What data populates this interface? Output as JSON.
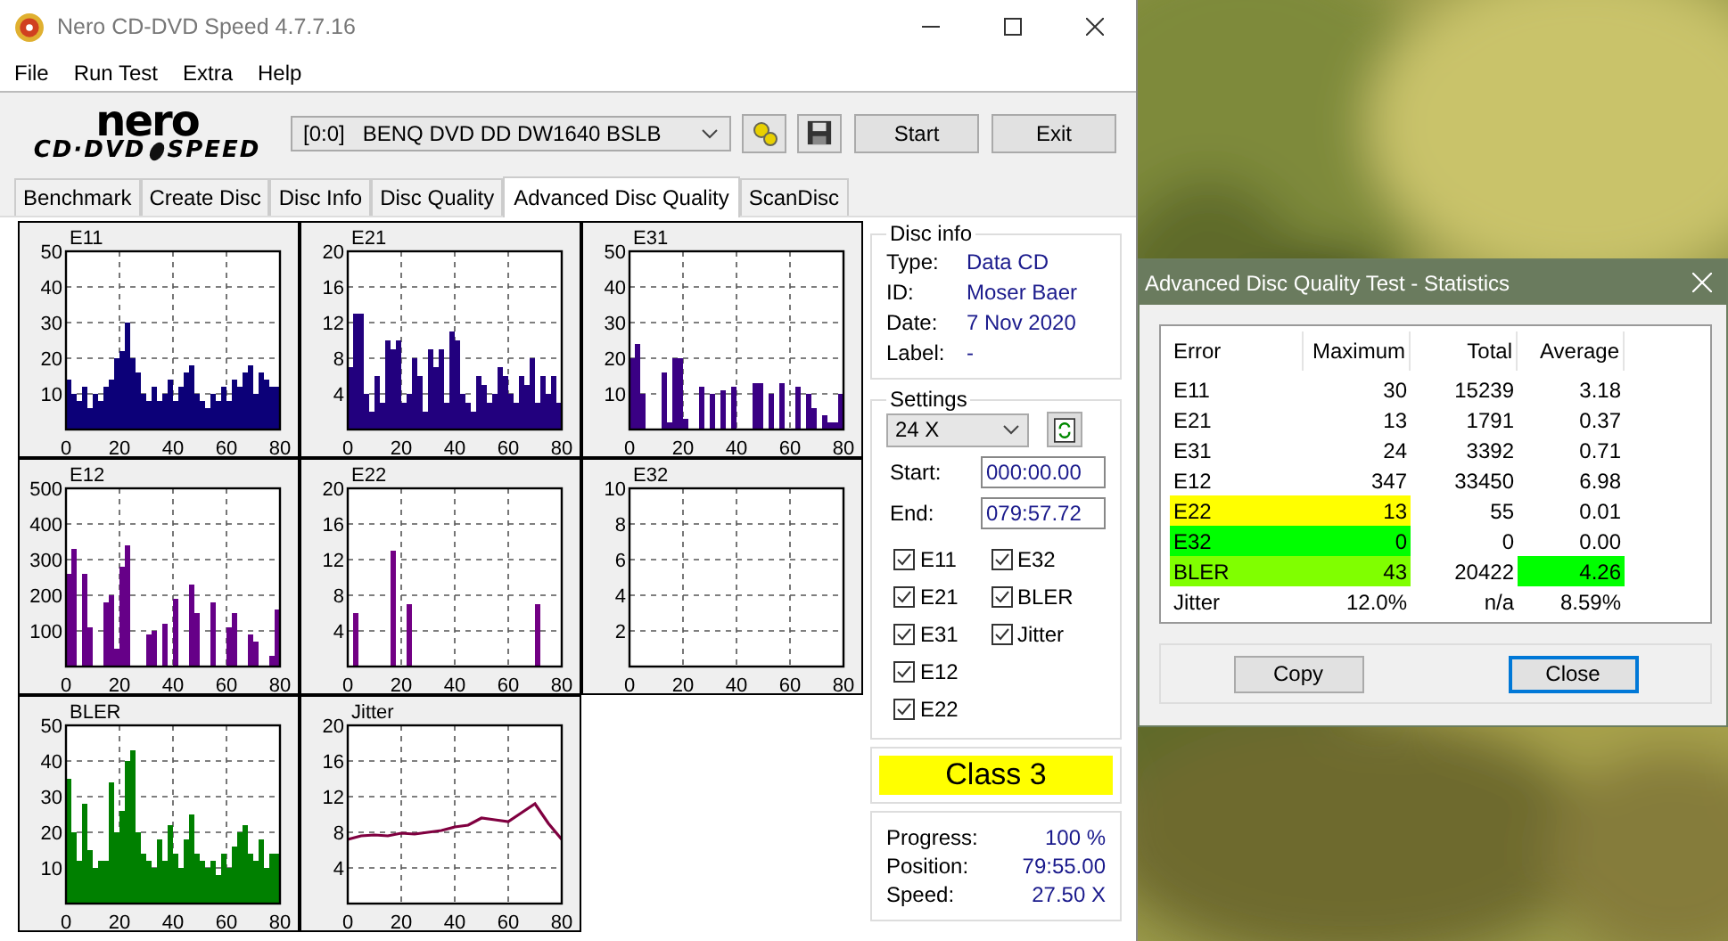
{
  "window": {
    "title": "Nero CD-DVD Speed 4.7.7.16"
  },
  "menu": [
    "File",
    "Run Test",
    "Extra",
    "Help"
  ],
  "logo": {
    "brand": "nero",
    "line1": "CD·DVD",
    "line2": "SPEED"
  },
  "toolbar": {
    "drive": "[0:0]   BENQ DVD DD DW1640 BSLB",
    "buttons": [
      "Start",
      "Exit"
    ]
  },
  "tabs": [
    {
      "label": "Benchmark",
      "selected": false
    },
    {
      "label": "Create Disc",
      "selected": false
    },
    {
      "label": "Disc Info",
      "selected": false
    },
    {
      "label": "Disc Quality",
      "selected": false
    },
    {
      "label": "Advanced Disc Quality",
      "selected": true
    },
    {
      "label": "ScanDisc",
      "selected": false
    }
  ],
  "charts": [
    {
      "chart_data": {
        "type": "bar",
        "title": "E11",
        "x": [
          0,
          2,
          4,
          6,
          8,
          10,
          12,
          14,
          16,
          18,
          20,
          22,
          24,
          26,
          28,
          30,
          32,
          34,
          36,
          38,
          40,
          42,
          44,
          46,
          48,
          50,
          52,
          54,
          56,
          58,
          60,
          62,
          64,
          66,
          68,
          70,
          72,
          74,
          76,
          78
        ],
        "series": [
          {
            "color": "#0c0078",
            "values": [
              14,
              10,
              8,
              12,
              6,
              10,
              8,
              12,
              14,
              20,
              22,
              30,
              20,
              16,
              10,
              8,
              12,
              8,
              10,
              14,
              8,
              12,
              16,
              18,
              10,
              8,
              6,
              10,
              8,
              12,
              8,
              14,
              12,
              16,
              18,
              10,
              16,
              14,
              12,
              12
            ]
          }
        ],
        "xlim": [
          0,
          80
        ],
        "ylim": [
          0,
          50
        ],
        "xticks": [
          0,
          20,
          40,
          60,
          80
        ],
        "yticks": [
          10,
          20,
          30,
          40,
          50
        ],
        "grid": true
      }
    },
    {
      "chart_data": {
        "type": "bar",
        "title": "E21",
        "x": [
          0,
          2,
          4,
          6,
          8,
          10,
          12,
          14,
          16,
          18,
          20,
          22,
          24,
          26,
          28,
          30,
          32,
          34,
          36,
          38,
          40,
          42,
          44,
          46,
          48,
          50,
          52,
          54,
          56,
          58,
          60,
          62,
          64,
          66,
          68,
          70,
          72,
          74,
          76,
          78
        ],
        "series": [
          {
            "color": "#22007e",
            "values": [
              7,
              13,
              13,
              4,
              2,
              6,
              3,
              10,
              9,
              10,
              3,
              4,
              8,
              6,
              2,
              9,
              7,
              9,
              3,
              11,
              10,
              4,
              3,
              2,
              6,
              5,
              3,
              4,
              7,
              6,
              4,
              3,
              6,
              5,
              8,
              3,
              6,
              4,
              6,
              3
            ]
          }
        ],
        "xlim": [
          0,
          80
        ],
        "ylim": [
          0,
          20
        ],
        "xticks": [
          0,
          20,
          40,
          60,
          80
        ],
        "yticks": [
          4,
          8,
          12,
          16,
          20
        ],
        "grid": true
      }
    },
    {
      "chart_data": {
        "type": "bar",
        "title": "E31",
        "x": [
          0,
          2,
          4,
          6,
          8,
          10,
          12,
          14,
          16,
          18,
          20,
          22,
          24,
          26,
          28,
          30,
          32,
          34,
          36,
          38,
          40,
          42,
          44,
          46,
          48,
          50,
          52,
          54,
          56,
          58,
          60,
          62,
          64,
          66,
          68,
          70,
          72,
          74,
          76,
          78
        ],
        "series": [
          {
            "color": "#3a0084",
            "values": [
              20,
              24,
              10,
              0,
              0,
              0,
              16,
              2,
              20,
              20,
              3,
              0,
              0,
              12,
              0,
              10,
              0,
              11,
              0,
              12,
              0,
              0,
              0,
              13,
              13,
              0,
              10,
              0,
              13,
              0,
              0,
              12,
              0,
              10,
              6,
              0,
              4,
              2,
              2,
              10
            ]
          }
        ],
        "xlim": [
          0,
          80
        ],
        "ylim": [
          0,
          50
        ],
        "xticks": [
          0,
          20,
          40,
          60,
          80
        ],
        "yticks": [
          10,
          20,
          30,
          40,
          50
        ],
        "grid": true
      }
    },
    {
      "chart_data": {
        "type": "bar",
        "title": "E12",
        "x": [
          0,
          2,
          4,
          6,
          8,
          10,
          12,
          14,
          16,
          18,
          20,
          22,
          24,
          26,
          28,
          30,
          32,
          34,
          36,
          38,
          40,
          42,
          44,
          46,
          48,
          50,
          52,
          54,
          56,
          58,
          60,
          62,
          64,
          66,
          68,
          70,
          72,
          74,
          76,
          78
        ],
        "series": [
          {
            "color": "#660088",
            "values": [
              260,
              330,
              0,
              260,
              110,
              0,
              0,
              180,
              200,
              50,
              280,
              340,
              0,
              0,
              0,
              90,
              100,
              0,
              120,
              0,
              190,
              0,
              0,
              230,
              150,
              0,
              0,
              180,
              0,
              0,
              110,
              150,
              0,
              0,
              90,
              70,
              0,
              0,
              30,
              160
            ]
          }
        ],
        "xlim": [
          0,
          80
        ],
        "ylim": [
          0,
          500
        ],
        "xticks": [
          0,
          20,
          40,
          60,
          80
        ],
        "yticks": [
          100,
          200,
          300,
          400,
          500
        ],
        "grid": true
      }
    },
    {
      "chart_data": {
        "type": "bar",
        "title": "E22",
        "x": [
          0,
          2,
          4,
          6,
          8,
          10,
          12,
          14,
          16,
          18,
          20,
          22,
          24,
          26,
          28,
          30,
          32,
          34,
          36,
          38,
          40,
          42,
          44,
          46,
          48,
          50,
          52,
          54,
          56,
          58,
          60,
          62,
          64,
          66,
          68,
          70,
          72,
          74,
          76,
          78
        ],
        "series": [
          {
            "color": "#720084",
            "values": [
              0,
              6,
              0,
              0,
              0,
              0,
              0,
              0,
              13,
              0,
              0,
              7,
              0,
              0,
              0,
              0,
              0,
              0,
              0,
              0,
              0,
              0,
              0,
              0,
              0,
              0,
              0,
              0,
              0,
              0,
              0,
              0,
              0,
              0,
              0,
              7,
              0,
              0,
              0,
              0
            ]
          }
        ],
        "xlim": [
          0,
          80
        ],
        "ylim": [
          0,
          20
        ],
        "xticks": [
          0,
          20,
          40,
          60,
          80
        ],
        "yticks": [
          4,
          8,
          12,
          16,
          20
        ],
        "grid": true
      }
    },
    {
      "chart_data": {
        "type": "bar",
        "title": "E32",
        "x": [
          0,
          2,
          4,
          6,
          8,
          10,
          12,
          14,
          16,
          18,
          20,
          22,
          24,
          26,
          28,
          30,
          32,
          34,
          36,
          38,
          40,
          42,
          44,
          46,
          48,
          50,
          52,
          54,
          56,
          58,
          60,
          62,
          64,
          66,
          68,
          70,
          72,
          74,
          76,
          78
        ],
        "series": [
          {
            "values": [
              0,
              0,
              0,
              0,
              0,
              0,
              0,
              0,
              0,
              0,
              0,
              0,
              0,
              0,
              0,
              0,
              0,
              0,
              0,
              0,
              0,
              0,
              0,
              0,
              0,
              0,
              0,
              0,
              0,
              0,
              0,
              0,
              0,
              0,
              0,
              0,
              0,
              0,
              0,
              0
            ]
          }
        ],
        "xlim": [
          0,
          80
        ],
        "ylim": [
          0,
          10
        ],
        "xticks": [
          0,
          20,
          40,
          60,
          80
        ],
        "yticks": [
          2,
          4,
          6,
          8,
          10
        ],
        "grid": true
      }
    },
    {
      "chart_data": {
        "type": "bar",
        "title": "BLER",
        "x": [
          0,
          2,
          4,
          6,
          8,
          10,
          12,
          14,
          16,
          18,
          20,
          22,
          24,
          26,
          28,
          30,
          32,
          34,
          36,
          38,
          40,
          42,
          44,
          46,
          48,
          50,
          52,
          54,
          56,
          58,
          60,
          62,
          64,
          66,
          68,
          70,
          72,
          74,
          76,
          78
        ],
        "series": [
          {
            "color": "#008000",
            "values": [
              35,
              20,
              12,
              28,
              15,
              10,
              12,
              12,
              34,
              20,
              26,
              40,
              43,
              20,
              14,
              12,
              10,
              18,
              12,
              22,
              14,
              10,
              18,
              25,
              14,
              12,
              10,
              12,
              8,
              14,
              10,
              16,
              20,
              22,
              14,
              12,
              18,
              10,
              14,
              14
            ]
          }
        ],
        "xlim": [
          0,
          80
        ],
        "ylim": [
          0,
          50
        ],
        "xticks": [
          0,
          20,
          40,
          60,
          80
        ],
        "yticks": [
          10,
          20,
          30,
          40,
          50
        ],
        "grid": true
      }
    },
    {
      "chart_data": {
        "type": "line",
        "title": "Jitter",
        "x": [
          0,
          5,
          10,
          15,
          20,
          25,
          30,
          35,
          40,
          45,
          50,
          55,
          60,
          65,
          70,
          75,
          80
        ],
        "series": [
          {
            "color": "#800040",
            "values": [
              7.2,
              7.6,
              7.7,
              7.6,
              7.9,
              7.8,
              8.0,
              8.2,
              8.6,
              8.8,
              9.6,
              9.4,
              9.2,
              10.2,
              11.2,
              9.0,
              7.2
            ]
          }
        ],
        "xlim": [
          0,
          80
        ],
        "ylim": [
          0,
          20
        ],
        "xticks": [
          0,
          20,
          40,
          60,
          80
        ],
        "yticks": [
          4,
          8,
          12,
          16,
          20
        ],
        "grid": true
      }
    }
  ],
  "disc_info": {
    "title": "Disc info",
    "fields": [
      {
        "label": "Type:",
        "value": "Data CD"
      },
      {
        "label": "ID:",
        "value": "Moser Baer"
      },
      {
        "label": "Date:",
        "value": "7 Nov 2020"
      },
      {
        "label": "Label:",
        "value": "-"
      }
    ]
  },
  "settings": {
    "title": "Settings",
    "speed": "24 X",
    "start_label": "Start:",
    "start": "000:00.00",
    "end_label": "End:",
    "end": "079:57.72",
    "checks": [
      {
        "label": "E11",
        "checked": true
      },
      {
        "label": "E21",
        "checked": true
      },
      {
        "label": "E31",
        "checked": true
      },
      {
        "label": "E12",
        "checked": true
      },
      {
        "label": "E22",
        "checked": true
      },
      {
        "label": "E32",
        "checked": true
      },
      {
        "label": "BLER",
        "checked": true
      },
      {
        "label": "Jitter",
        "checked": true
      }
    ]
  },
  "class": {
    "label": "Class 3",
    "color": "#ffff00"
  },
  "progress": [
    {
      "label": "Progress:",
      "value": "100 %"
    },
    {
      "label": "Position:",
      "value": "79:55.00"
    },
    {
      "label": "Speed:",
      "value": "27.50 X"
    }
  ],
  "dialog": {
    "title": "Advanced Disc Quality Test - Statistics",
    "columns": [
      "Error",
      "Maximum",
      "Total",
      "Average"
    ],
    "rows": [
      {
        "cells": [
          {
            "text": "E11"
          },
          {
            "text": "30"
          },
          {
            "text": "15239"
          },
          {
            "text": "3.18"
          }
        ]
      },
      {
        "cells": [
          {
            "text": "E21"
          },
          {
            "text": "13"
          },
          {
            "text": "1791"
          },
          {
            "text": "0.37"
          }
        ]
      },
      {
        "cells": [
          {
            "text": "E31"
          },
          {
            "text": "24"
          },
          {
            "text": "3392"
          },
          {
            "text": "0.71"
          }
        ]
      },
      {
        "cells": [
          {
            "text": "E12"
          },
          {
            "text": "347"
          },
          {
            "text": "33450"
          },
          {
            "text": "6.98"
          }
        ]
      },
      {
        "cells": [
          {
            "text": "E22",
            "color": "#ffff00"
          },
          {
            "text": "13",
            "color": "#ffff00"
          },
          {
            "text": "55"
          },
          {
            "text": "0.01"
          }
        ]
      },
      {
        "cells": [
          {
            "text": "E32",
            "color": "#00ff00"
          },
          {
            "text": "0",
            "color": "#00ff00"
          },
          {
            "text": "0"
          },
          {
            "text": "0.00"
          }
        ]
      },
      {
        "cells": [
          {
            "text": "BLER",
            "color": "#80ff00"
          },
          {
            "text": "43",
            "color": "#80ff00"
          },
          {
            "text": "20422"
          },
          {
            "text": "4.26",
            "color": "#00ff00"
          }
        ]
      },
      {
        "cells": [
          {
            "text": "Jitter"
          },
          {
            "text": "12.0%"
          },
          {
            "text": "n/a"
          },
          {
            "text": "8.59%"
          }
        ]
      }
    ],
    "buttons": [
      {
        "label": "Copy",
        "focused": false
      },
      {
        "label": "Close",
        "focused": true
      }
    ]
  }
}
